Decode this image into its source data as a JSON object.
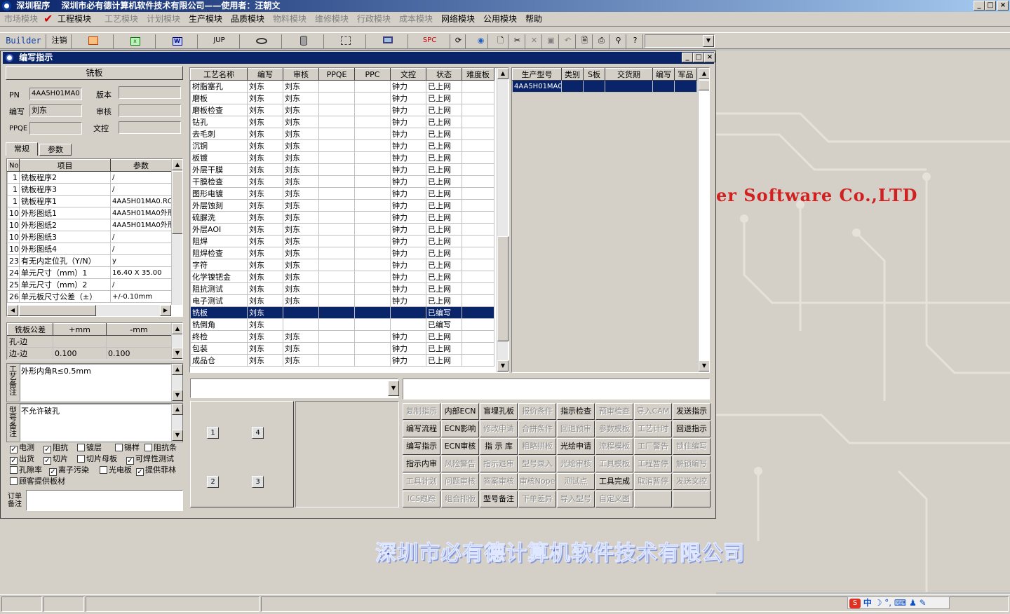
{
  "app": {
    "title": "深圳程序　 深圳市必有德计算机软件技术有限公司——使用者：汪朝文",
    "min": "_",
    "max": "□",
    "close": "×"
  },
  "menu": [
    "市场模块",
    "工程模块",
    "工艺模块",
    "计划模块",
    "生产模块",
    "品质模块",
    "物料模块",
    "维修模块",
    "行政模块",
    "成本模块",
    "网络模块",
    "公用模块",
    "帮助"
  ],
  "toolbar": {
    "builder": "Builder",
    "logout": "注销",
    "jup": "JUP",
    "spc": "SPC"
  },
  "desktop": {
    "company_en": "er Software Co.,LTD",
    "company_cn": "深圳市必有德计算机软件技术有限公司"
  },
  "window": {
    "title": "编写指示"
  },
  "left": {
    "header": "铣板",
    "pn_label": "PN",
    "pn_value": "4AA5H01MA0",
    "version_label": "版本",
    "writer_label": "编写",
    "writer_value": "刘东",
    "review_label": "审核",
    "ppqe_label": "PPQE",
    "doc_label": "文控",
    "tab_general": "常规",
    "tab_params": "参数",
    "param_cols": [
      "No",
      "项目",
      "参数"
    ],
    "params": [
      [
        "1",
        "铣板程序2",
        "/"
      ],
      [
        "1",
        "铣板程序3",
        "/"
      ],
      [
        "1",
        "铣板程序1",
        "4AA5H01MA0.ROU"
      ],
      [
        "10",
        "外形图纸1",
        "4AA5H01MA0外形"
      ],
      [
        "10",
        "外形图纸2",
        "4AA5H01MA0外形"
      ],
      [
        "10",
        "外形图纸3",
        "/"
      ],
      [
        "10",
        "外形图纸4",
        "/"
      ],
      [
        "23",
        "有无内定位孔（Y/N）",
        "y"
      ],
      [
        "24",
        "单元尺寸（mm）1",
        "16.40 X 35.00"
      ],
      [
        "25",
        "单元尺寸（mm）2",
        "/"
      ],
      [
        "26",
        "单元板尺寸公差（±）",
        "+/-0.10mm"
      ]
    ],
    "tol_cols": [
      "铣板公差",
      "+mm",
      "-mm"
    ],
    "tols": [
      [
        "孔-边",
        "",
        ""
      ],
      [
        "边-边",
        "0.100",
        "0.100"
      ]
    ],
    "process_note_label": "工艺备注",
    "process_note": "外形内角R≤0.5mm",
    "model_note_label": "型号备注",
    "model_note": "不允许破孔",
    "checks": [
      {
        "label": "电测",
        "checked": true
      },
      {
        "label": "阻抗",
        "checked": true
      },
      {
        "label": "镀层",
        "checked": false
      },
      {
        "label": "锡样",
        "checked": false
      },
      {
        "label": "阻抗条",
        "checked": false
      },
      {
        "label": "出货",
        "checked": true
      },
      {
        "label": "切片",
        "checked": true
      },
      {
        "label": "切片母板",
        "checked": false
      },
      {
        "label": "可焊性测试",
        "checked": true
      },
      {
        "label": "孔隙率",
        "checked": false
      },
      {
        "label": "离子污染",
        "checked": true
      },
      {
        "label": "光电板",
        "checked": false
      },
      {
        "label": "提供菲林",
        "checked": true
      },
      {
        "label": "顾客提供板材",
        "checked": false
      }
    ],
    "order_note_label": "订单备注"
  },
  "process": {
    "cols": [
      "工艺名称",
      "编写",
      "审核",
      "PPQE",
      "PPC",
      "文控",
      "状态",
      "难度板"
    ],
    "rows": [
      [
        "树脂塞孔",
        "刘东",
        "刘东",
        "",
        "",
        "钟力",
        "已上网",
        ""
      ],
      [
        "磨板",
        "刘东",
        "刘东",
        "",
        "",
        "钟力",
        "已上网",
        ""
      ],
      [
        "磨板检查",
        "刘东",
        "刘东",
        "",
        "",
        "钟力",
        "已上网",
        ""
      ],
      [
        "钻孔",
        "刘东",
        "刘东",
        "",
        "",
        "钟力",
        "已上网",
        ""
      ],
      [
        "去毛刺",
        "刘东",
        "刘东",
        "",
        "",
        "钟力",
        "已上网",
        ""
      ],
      [
        "沉铜",
        "刘东",
        "刘东",
        "",
        "",
        "钟力",
        "已上网",
        ""
      ],
      [
        "板镀",
        "刘东",
        "刘东",
        "",
        "",
        "钟力",
        "已上网",
        ""
      ],
      [
        "外层干膜",
        "刘东",
        "刘东",
        "",
        "",
        "钟力",
        "已上网",
        ""
      ],
      [
        "干膜检查",
        "刘东",
        "刘东",
        "",
        "",
        "钟力",
        "已上网",
        ""
      ],
      [
        "图形电镀",
        "刘东",
        "刘东",
        "",
        "",
        "钟力",
        "已上网",
        ""
      ],
      [
        "外层蚀刻",
        "刘东",
        "刘东",
        "",
        "",
        "钟力",
        "已上网",
        ""
      ],
      [
        "硫脲洗",
        "刘东",
        "刘东",
        "",
        "",
        "钟力",
        "已上网",
        ""
      ],
      [
        "外层AOI",
        "刘东",
        "刘东",
        "",
        "",
        "钟力",
        "已上网",
        ""
      ],
      [
        "阻焊",
        "刘东",
        "刘东",
        "",
        "",
        "钟力",
        "已上网",
        ""
      ],
      [
        "阻焊检查",
        "刘东",
        "刘东",
        "",
        "",
        "钟力",
        "已上网",
        ""
      ],
      [
        "字符",
        "刘东",
        "刘东",
        "",
        "",
        "钟力",
        "已上网",
        ""
      ],
      [
        "化学镍钯金",
        "刘东",
        "刘东",
        "",
        "",
        "钟力",
        "已上网",
        ""
      ],
      [
        "阻抗测试",
        "刘东",
        "刘东",
        "",
        "",
        "钟力",
        "已上网",
        ""
      ],
      [
        "电子测试",
        "刘东",
        "刘东",
        "",
        "",
        "钟力",
        "已上网",
        ""
      ],
      [
        "铣板",
        "刘东",
        "",
        "",
        "",
        "",
        "已编写",
        ""
      ],
      [
        "铣倒角",
        "刘东",
        "",
        "",
        "",
        "",
        "已编写",
        ""
      ],
      [
        "终检",
        "刘东",
        "刘东",
        "",
        "",
        "钟力",
        "已上网",
        ""
      ],
      [
        "包装",
        "刘东",
        "刘东",
        "",
        "",
        "钟力",
        "已上网",
        ""
      ],
      [
        "成品仓",
        "刘东",
        "刘东",
        "",
        "",
        "钟力",
        "已上网",
        ""
      ]
    ],
    "selected": 19
  },
  "models": {
    "cols": [
      "生产型号",
      "类别",
      "S板",
      "交货期",
      "编写",
      "军品"
    ],
    "rows": [
      [
        "4AA5H01MA0",
        "",
        "",
        "",
        "",
        ""
      ]
    ]
  },
  "pads": [
    "1",
    "4",
    "2",
    "3"
  ],
  "actions": [
    [
      {
        "t": "复制指示",
        "e": false
      },
      {
        "t": "内部ECN",
        "e": true
      },
      {
        "t": "盲埋孔板",
        "e": true
      },
      {
        "t": "报价条件",
        "e": false
      },
      {
        "t": "指示检查",
        "e": true
      },
      {
        "t": "预审检查",
        "e": false
      },
      {
        "t": "导入CAM",
        "e": false
      },
      {
        "t": "发送指示",
        "e": true
      }
    ],
    [
      {
        "t": "编写流程",
        "e": true
      },
      {
        "t": "ECN影响",
        "e": true
      },
      {
        "t": "修改申请",
        "e": false
      },
      {
        "t": "合拼条件",
        "e": false
      },
      {
        "t": "回退预审",
        "e": false
      },
      {
        "t": "参数模板",
        "e": false
      },
      {
        "t": "工艺计时",
        "e": false
      },
      {
        "t": "回退指示",
        "e": true
      }
    ],
    [
      {
        "t": "编写指示",
        "e": true
      },
      {
        "t": "ECN审核",
        "e": true
      },
      {
        "t": "指 示 库",
        "e": true
      },
      {
        "t": "粗略拼板",
        "e": false
      },
      {
        "t": "光绘申请",
        "e": true
      },
      {
        "t": "流程模板",
        "e": false
      },
      {
        "t": "工厂警告",
        "e": false
      },
      {
        "t": "锁住编写",
        "e": false
      }
    ],
    [
      {
        "t": "指示内审",
        "e": true
      },
      {
        "t": "风险警告",
        "e": false
      },
      {
        "t": "指示退审",
        "e": false
      },
      {
        "t": "型号录入",
        "e": false
      },
      {
        "t": "光绘审核",
        "e": false
      },
      {
        "t": "工具模板",
        "e": false
      },
      {
        "t": "工程暂停",
        "e": false
      },
      {
        "t": "解锁编写",
        "e": false
      }
    ],
    [
      {
        "t": "工具计划",
        "e": false
      },
      {
        "t": "问题审核",
        "e": false
      },
      {
        "t": "答案审核",
        "e": false
      },
      {
        "t": "审核Nope",
        "e": false
      },
      {
        "t": "测试点",
        "e": false
      },
      {
        "t": "工具完成",
        "e": true
      },
      {
        "t": "取消暂停",
        "e": false
      },
      {
        "t": "发送文控",
        "e": false
      }
    ],
    [
      {
        "t": "ICS跟踪",
        "e": false
      },
      {
        "t": "组合排版",
        "e": false
      },
      {
        "t": "型号备注",
        "e": true
      },
      {
        "t": "下单差异",
        "e": false
      },
      {
        "t": "导入型号",
        "e": false
      },
      {
        "t": "自定义图",
        "e": false
      },
      {
        "t": "",
        "e": false
      },
      {
        "t": "",
        "e": false
      }
    ]
  ],
  "tray": {
    "ime": "中"
  }
}
